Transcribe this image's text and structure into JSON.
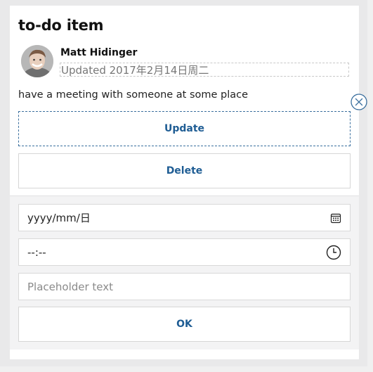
{
  "card": {
    "title": "to-do item",
    "author": "Matt Hidinger",
    "updated": "Updated 2017年2月14日周二",
    "body": "have a meeting with someone at some place"
  },
  "actions": {
    "update_label": "Update",
    "delete_label": "Delete"
  },
  "inputs": {
    "date_value": "yyyy/mm/日",
    "time_value": "--:--",
    "text_placeholder": "Placeholder text",
    "ok_label": "OK"
  },
  "icons": {
    "close": "close-circle-icon",
    "calendar": "calendar-icon",
    "clock": "clock-icon"
  },
  "colors": {
    "accent": "#1f5d94",
    "close_icon": "#3a6f9e"
  }
}
